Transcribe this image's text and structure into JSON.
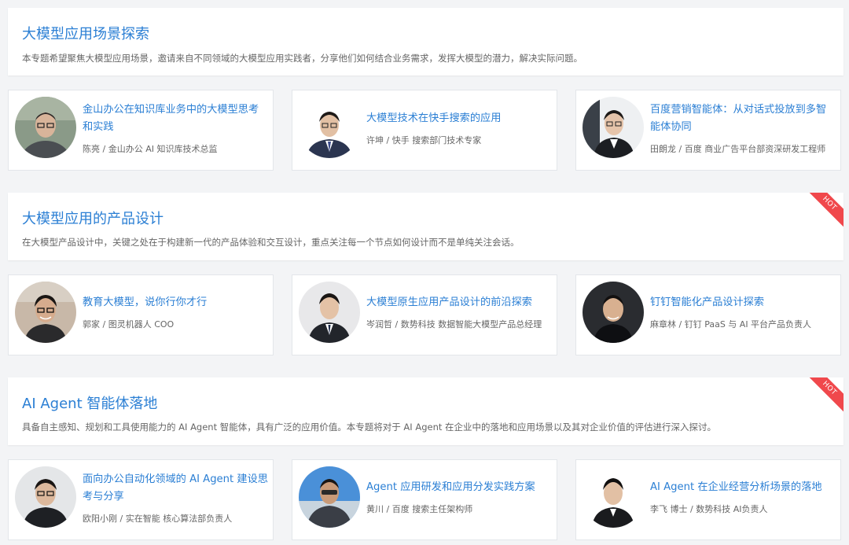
{
  "sections": [
    {
      "title": "大模型应用场景探索",
      "description": "本专题希望聚焦大模型应用场景，邀请来自不同领域的大模型应用实践者，分享他们如何结合业务需求，发挥大模型的潜力，解决实际问题。",
      "hot": false,
      "talks": [
        {
          "title": "金山办公在知识库业务中的大模型思考和实践",
          "speaker": "陈亮 / 金山办公 AI 知识库技术总监"
        },
        {
          "title": "大模型技术在快手搜索的应用",
          "speaker": "许坤 / 快手 搜索部门技术专家"
        },
        {
          "title": "百度营销智能体：从对话式投放到多智能体协同",
          "speaker": "田朗龙 / 百度 商业广告平台部资深研发工程师"
        }
      ]
    },
    {
      "title": "大模型应用的产品设计",
      "description": "在大模型产品设计中，关键之处在于构建新一代的产品体验和交互设计，重点关注每一个节点如何设计而不是单纯关注会话。",
      "hot": true,
      "hot_label": "HOT",
      "talks": [
        {
          "title": "教育大模型，说你行你才行",
          "speaker": "郭家 / 图灵机器人 COO"
        },
        {
          "title": "大模型原生应用产品设计的前沿探索",
          "speaker": "岑润哲 / 数势科技 数据智能大模型产品总经理"
        },
        {
          "title": "钉钉智能化产品设计探索",
          "speaker": "麻章林 / 钉钉 PaaS 与 AI 平台产品负责人"
        }
      ]
    },
    {
      "title": "AI Agent 智能体落地",
      "description": "具备自主感知、规划和工具使用能力的 AI Agent 智能体，具有广泛的应用价值。本专题将对于 AI Agent 在企业中的落地和应用场景以及其对企业价值的评估进行深入探讨。",
      "hot": true,
      "hot_label": "HOT",
      "talks": [
        {
          "title": "面向办公自动化领域的 AI Agent 建设思考与分享",
          "speaker": "欧阳小刚 / 实在智能 核心算法部负责人"
        },
        {
          "title": "Agent 应用研发和应用分发实践方案",
          "speaker": "黄川 / 百度 搜索主任架构师"
        },
        {
          "title": "AI Agent 在企业经营分析场景的落地",
          "speaker": "李飞 博士 / 数势科技 AI负责人"
        }
      ]
    }
  ],
  "colors": {
    "accent": "#2b7fd4",
    "hot": "#f0484c",
    "background": "#f3f4f6"
  }
}
